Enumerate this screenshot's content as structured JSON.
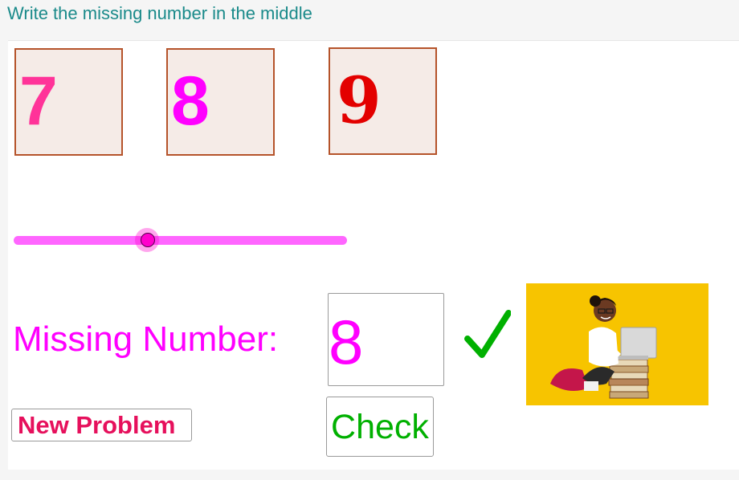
{
  "header": {
    "title": "Write the missing number in the middle"
  },
  "sequence": {
    "first": "7",
    "middle": "8",
    "last": "9",
    "colors": {
      "first": "#ff3399",
      "middle": "#ff00ff",
      "last": "#e30000",
      "box_fill": "#f5ebe7",
      "box_border": "#b5532a"
    }
  },
  "slider": {
    "value_fraction": 0.4,
    "color": "#ff66ff"
  },
  "answer": {
    "label": "Missing Number:",
    "value": "8",
    "status_icon": "checkmark-icon",
    "status_color": "#00b000"
  },
  "illustration": {
    "icon": "girl-with-laptop-on-books",
    "background": "#f7c400"
  },
  "buttons": {
    "new_problem": "New Problem",
    "check": "Check"
  }
}
